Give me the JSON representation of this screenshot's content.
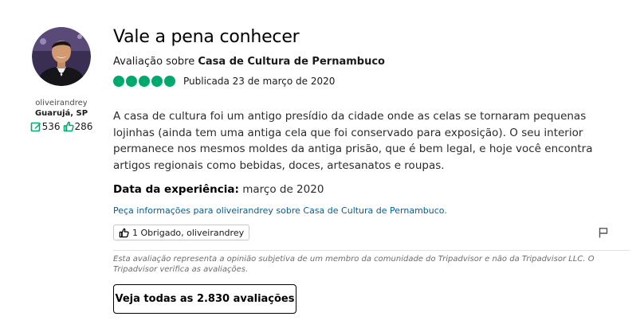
{
  "reviewer": {
    "username": "oliveirandrey",
    "location": "Guarujá, SP",
    "contributions": "536",
    "helpful_votes": "286"
  },
  "review": {
    "title": "Vale a pena conhecer",
    "subtitle_prefix": "Avaliação sobre ",
    "place": "Casa de Cultura de Pernambuco",
    "rating": 5,
    "rating_max": 5,
    "published": "Publicada 23 de março de 2020",
    "text": "A casa de cultura foi um antigo presídio da cidade onde as celas se tornaram pequenas lojinhas (ainda tem uma antiga cela que foi conservado para exposição). O seu interior permanece nos mesmos moldes da antiga prisão, que é bem legal, e hoje você encontra artigos regionais como bebidas, doces, artesanatos e roupas.",
    "experience_label": "Data da experiência:",
    "experience_value": " março de 2020",
    "ask_link": "Peça informações para oliveirandrey sobre Casa de Cultura de Pernambuco.",
    "helpful_button": "1 Obrigado, oliveirandrey"
  },
  "footer": {
    "disclaimer": "Esta avaliação representa a opinião subjetiva de um membro da comunidade do Tripadvisor e não da Tripadvisor LLC. O Tripadvisor verifica as avaliações.",
    "see_all_button": "Veja todas as 2.830 avaliações"
  },
  "colors": {
    "rating_green": "#00aa6c",
    "link_blue": "#0a5c8c"
  },
  "icons": [
    "avatar-photo",
    "edit-icon",
    "thumbs-up-icon",
    "flag-icon"
  ]
}
